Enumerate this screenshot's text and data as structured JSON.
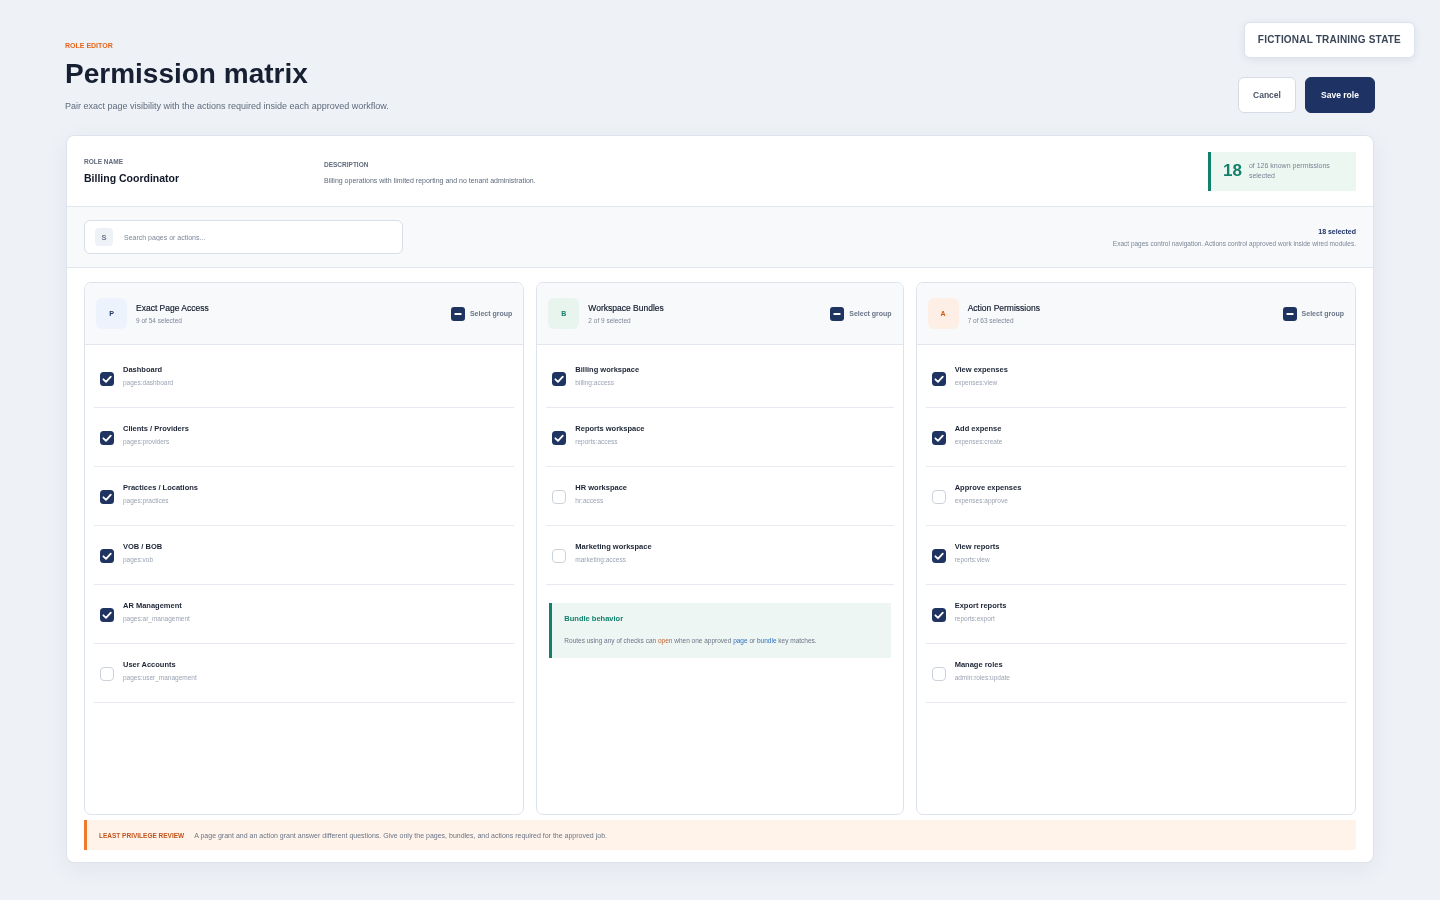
{
  "header": {
    "eyebrow": "ROLE EDITOR",
    "title": "Permission matrix",
    "subtitle": "Pair exact page visibility with the actions required inside each approved workflow.",
    "status_badge": "FICTIONAL TRAINING STATE",
    "buttons": [
      {
        "label": "Cancel",
        "kind": "secondary"
      },
      {
        "label": "Save role",
        "kind": "primary"
      }
    ]
  },
  "role": {
    "name_label": "ROLE NAME",
    "name": "Billing Coordinator",
    "description_label": "DESCRIPTION",
    "description": "Billing operations with limited reporting and no tenant administration.",
    "summary": {
      "count": "18",
      "text": "of 126 known permissions selected"
    }
  },
  "filter": {
    "search": {
      "icon_letter": "S",
      "placeholder": "Search pages or actions..."
    },
    "selected": "18 selected",
    "hint": "Exact pages control navigation. Actions control approved work inside wired modules."
  },
  "groups": [
    {
      "kind": "pages",
      "initial": "P",
      "title": "Exact Page Access",
      "count": "9 of 54 selected",
      "select_label": "Select group",
      "items": [
        {
          "label": "Dashboard",
          "key": "pages:dashboard",
          "checked": true
        },
        {
          "label": "Clients / Providers",
          "key": "pages:providers",
          "checked": true
        },
        {
          "label": "Practices / Locations",
          "key": "pages:practices",
          "checked": true
        },
        {
          "label": "VOB / BOB",
          "key": "pages:vob",
          "checked": true
        },
        {
          "label": "AR Management",
          "key": "pages:ar_management",
          "checked": true
        },
        {
          "label": "User Accounts",
          "key": "pages:user_management",
          "checked": false
        }
      ]
    },
    {
      "kind": "bundles",
      "initial": "B",
      "title": "Workspace Bundles",
      "count": "2 of 9 selected",
      "select_label": "Select group",
      "items": [
        {
          "label": "Billing workspace",
          "key": "billing:access",
          "checked": true
        },
        {
          "label": "Reports workspace",
          "key": "reports:access",
          "checked": true
        },
        {
          "label": "HR workspace",
          "key": "hr:access",
          "checked": false
        },
        {
          "label": "Marketing workspace",
          "key": "marketing:access",
          "checked": false
        }
      ],
      "note": {
        "title": "Bundle behavior",
        "parts": [
          {
            "kind": "plain",
            "text": "Routes using any of checks can "
          },
          {
            "kind": "action",
            "text": "open"
          },
          {
            "kind": "plain",
            "text": " when one approved "
          },
          {
            "kind": "key",
            "text": "page"
          },
          {
            "kind": "plain",
            "text": " or "
          },
          {
            "kind": "key",
            "text": "bundle"
          },
          {
            "kind": "plain",
            "text": " key matches."
          }
        ]
      }
    },
    {
      "kind": "actions",
      "initial": "A",
      "title": "Action Permissions",
      "count": "7 of 63 selected",
      "select_label": "Select group",
      "items": [
        {
          "label": "View expenses",
          "key": "expenses:view",
          "checked": true
        },
        {
          "label": "Add expense",
          "key": "expenses:create",
          "checked": true
        },
        {
          "label": "Approve expenses",
          "key": "expenses:approve",
          "checked": false
        },
        {
          "label": "View reports",
          "key": "reports:view",
          "checked": true
        },
        {
          "label": "Export reports",
          "key": "reports:export",
          "checked": true
        },
        {
          "label": "Manage roles",
          "key": "admin:roles:update",
          "checked": false
        }
      ]
    }
  ],
  "review": {
    "label": "LEAST PRIVILEGE REVIEW",
    "text": "A page grant and an action grant answer different questions. Give only the pages, bundles, and actions required for the approved job."
  }
}
